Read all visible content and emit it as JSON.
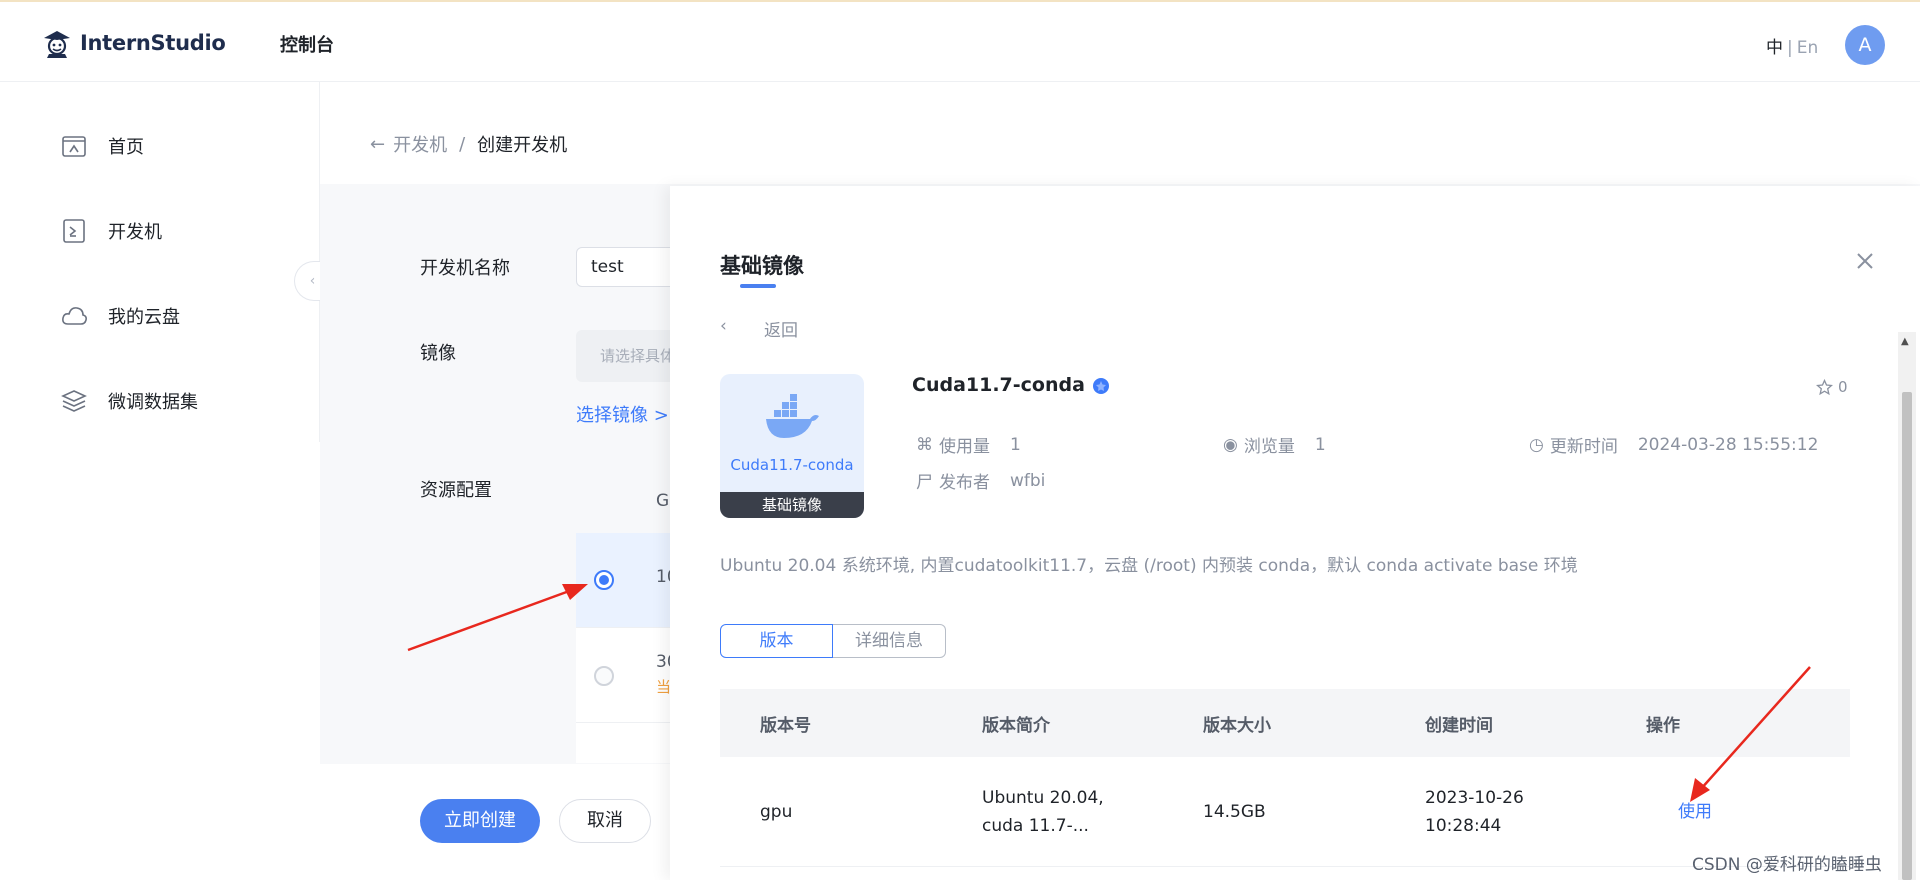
{
  "header": {
    "logo_text": "InternStudio",
    "console_title": "控制台",
    "lang_zh": "中",
    "lang_sep": "|",
    "lang_en": "En",
    "avatar_letter": "A"
  },
  "sidebar": {
    "items": [
      {
        "label": "首页",
        "icon": "home-icon"
      },
      {
        "label": "开发机",
        "icon": "terminal-icon"
      },
      {
        "label": "我的云盘",
        "icon": "cloud-icon"
      },
      {
        "label": "微调数据集",
        "icon": "layers-icon"
      }
    ]
  },
  "breadcrumb": {
    "parent": "开发机",
    "separator": "/",
    "current": "创建开发机"
  },
  "form": {
    "name_label": "开发机名称",
    "name_value": "test",
    "image_label": "镜像",
    "image_placeholder": "请选择具体镜像",
    "select_image_link": "选择镜像 >",
    "resource_label": "资源配置",
    "resource_table": {
      "header_partial": "G",
      "rows": [
        {
          "value_partial": "10",
          "selected": true,
          "note_partial": ""
        },
        {
          "value_partial": "30",
          "selected": false,
          "note_partial": "当"
        }
      ]
    },
    "create_button": "立即创建",
    "cancel_button": "取消"
  },
  "panel": {
    "title": "基础镜像",
    "back_text": "返回",
    "image": {
      "thumb_name": "Cuda11.7-conda",
      "thumb_badge": "基础镜像",
      "title": "Cuda11.7-conda",
      "star_count": "0",
      "usage_label": "使用量",
      "usage_value": "1",
      "views_label": "浏览量",
      "views_value": "1",
      "updated_label": "更新时间",
      "updated_value": "2024-03-28 15:55:12",
      "publisher_label": "发布者",
      "publisher_value": "wfbi",
      "description": "Ubuntu 20.04 系统环境, 内置cudatoolkit11.7，云盘 (/root) 内预装 conda，默认 conda activate base 环境"
    },
    "tabs": [
      "版本",
      "详细信息"
    ],
    "versions_table": {
      "columns": [
        "版本号",
        "版本简介",
        "版本大小",
        "创建时间",
        "操作"
      ],
      "rows": [
        {
          "version": "gpu",
          "summary_line1": "Ubuntu 20.04,",
          "summary_line2": "cuda 11.7-...",
          "size": "14.5GB",
          "created_line1": "2023-10-26",
          "created_line2": "10:28:44",
          "action": "使用"
        }
      ]
    }
  },
  "watermark": "CSDN @爱科研的瞌睡虫",
  "colors": {
    "accent": "#4a80f0",
    "link": "#3e7bfa",
    "annotation_arrow": "#e8281e",
    "thumb_bg": "#e8f0fd"
  }
}
